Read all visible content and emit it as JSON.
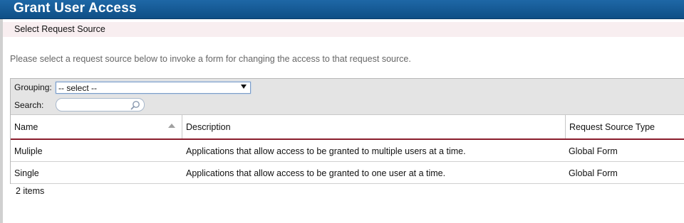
{
  "header": {
    "title": "Grant User Access"
  },
  "subheader": {
    "label": "Select Request Source"
  },
  "instructions": "Please select a request source below to invoke a form for changing the access to that request source.",
  "filters": {
    "grouping_label": "Grouping:",
    "grouping_value": "-- select --",
    "search_label": "Search:",
    "search_value": ""
  },
  "table": {
    "columns": [
      "Name",
      "Description",
      "Request Source Type"
    ],
    "sorted_column": "Name",
    "sort_direction": "ascending",
    "rows": [
      {
        "name": "Muliple",
        "description": "Applications that allow access to be granted to multiple users at a time.",
        "type": "Global Form"
      },
      {
        "name": "Single",
        "description": "Applications that allow access to be granted to one user at a time.",
        "type": "Global Form"
      }
    ]
  },
  "footer": {
    "count": "2 items"
  },
  "colors": {
    "title_bar": "#1a5f9c",
    "subheader_bg": "#f8eef0",
    "header_underline": "#8a1c2c",
    "filter_panel": "#e4e4e4"
  }
}
